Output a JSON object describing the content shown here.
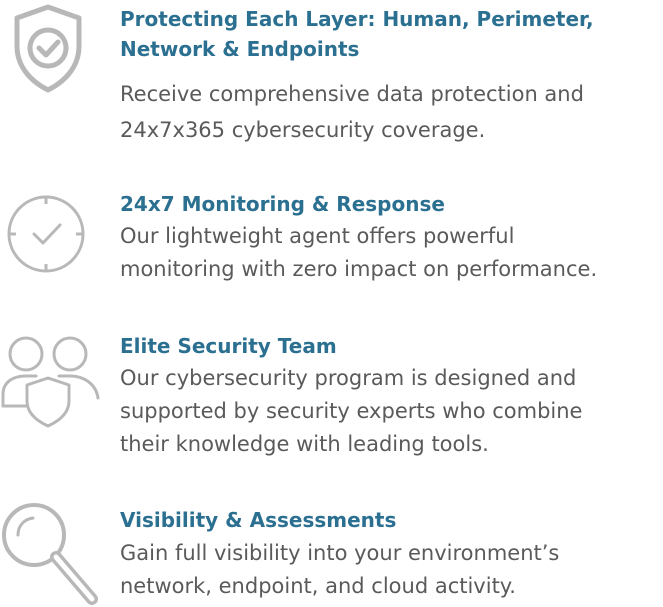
{
  "colors": {
    "title": "#2b6f91",
    "text": "#5a5a5a",
    "icon": "#b8b8b8",
    "background": "#ffffff"
  },
  "features": [
    {
      "icon": "shield-check-icon",
      "title_lines": [
        "Protecting Each Layer: Human, Perimeter,",
        "Network & Endpoints"
      ],
      "desc_lines": [
        "Receive comprehensive data protection and",
        "24x7x365 cybersecurity coverage."
      ]
    },
    {
      "icon": "clock-check-icon",
      "title_lines": [
        "24x7 Monitoring & Response"
      ],
      "desc_lines": [
        "Our lightweight agent offers powerful",
        "monitoring with zero impact on performance."
      ]
    },
    {
      "icon": "team-shield-icon",
      "title_lines": [
        "Elite Security Team"
      ],
      "desc_lines": [
        "Our cybersecurity program is designed and",
        "supported by security experts who combine",
        "their knowledge with leading tools."
      ]
    },
    {
      "icon": "magnifier-icon",
      "title_lines": [
        "Visibility & Assessments"
      ],
      "desc_lines": [
        "Gain full visibility into your environment’s",
        "network, endpoint, and cloud activity."
      ]
    }
  ]
}
